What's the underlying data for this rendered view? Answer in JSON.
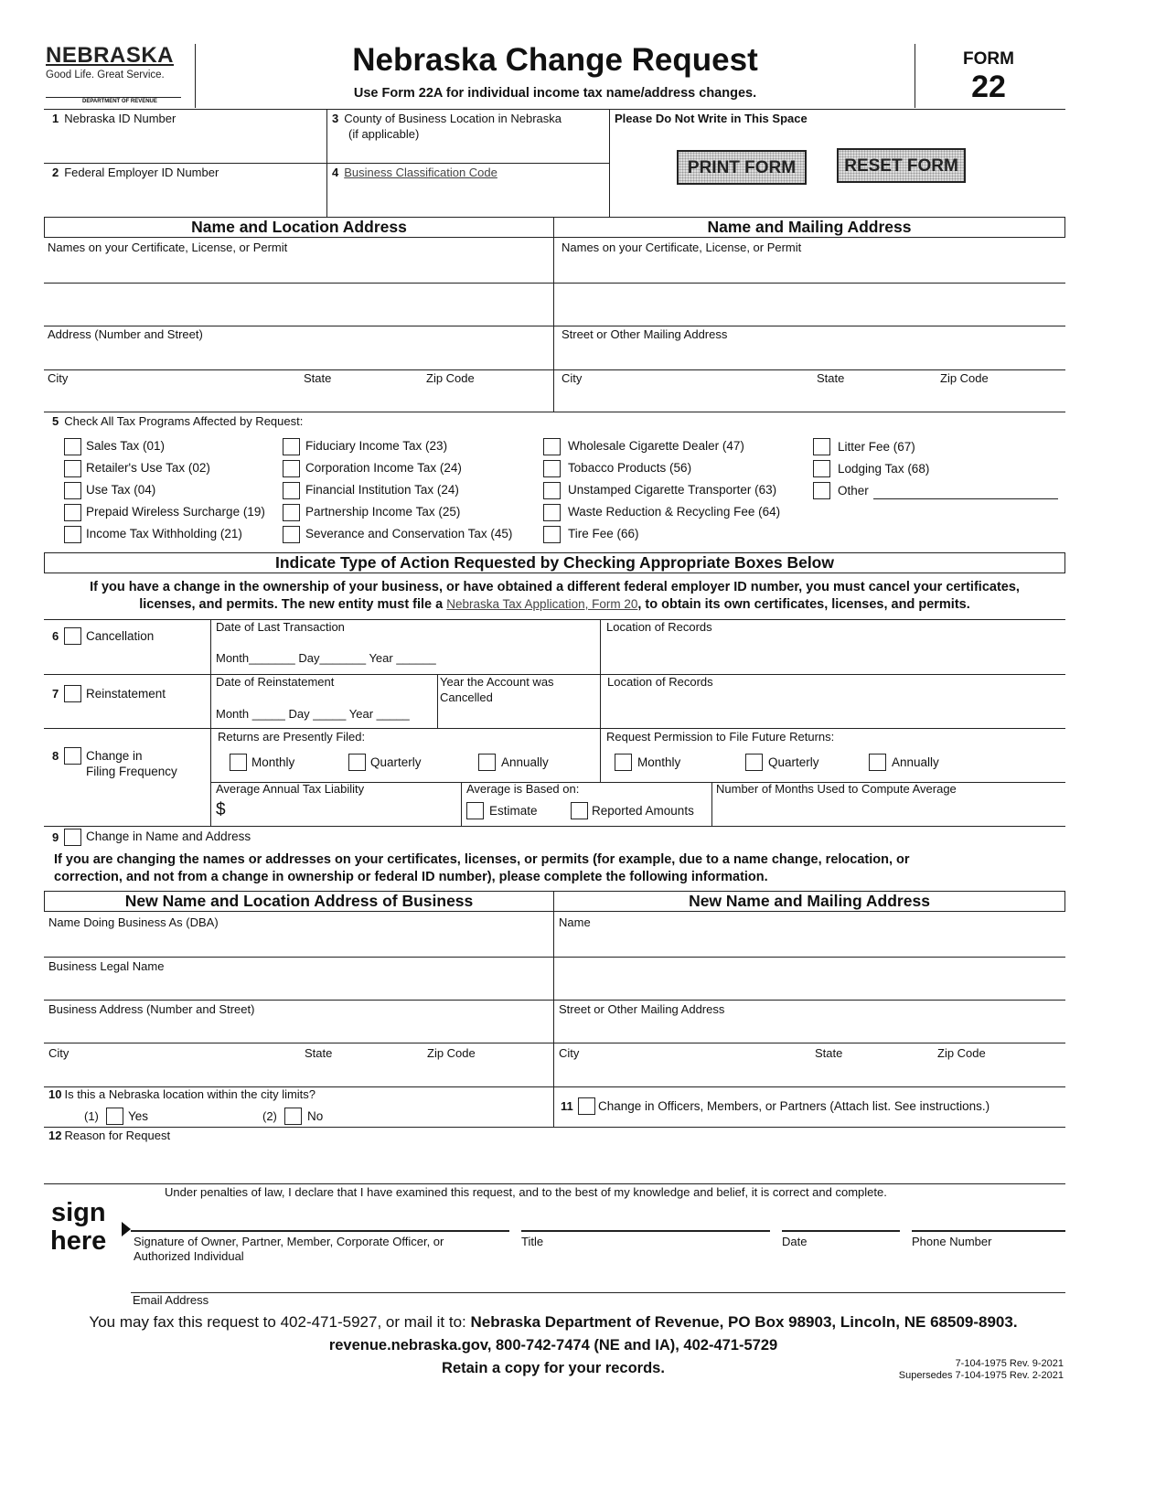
{
  "header": {
    "logo": {
      "name": "NEBRASKA",
      "tagline": "Good Life. Great Service.",
      "department": "DEPARTMENT OF REVENUE"
    },
    "title": "Nebraska Change Request",
    "subtitle": "Use Form 22A for individual income tax name/address changes.",
    "form_label": "FORM",
    "form_number": "22"
  },
  "top_fields": {
    "f1": {
      "num": "1",
      "label": "Nebraska ID Number"
    },
    "f2": {
      "num": "2",
      "label": "Federal Employer ID Number"
    },
    "f3": {
      "num": "3",
      "label": "County of Business Location in Nebraska",
      "label2": "(if applicable)"
    },
    "f4": {
      "num": "4",
      "label": "Business Classification Code"
    },
    "office_use": "Please Do Not Write in This Space",
    "print_button": "PRINT FORM",
    "reset_button": "RESET FORM"
  },
  "address_section": {
    "location_header": "Name and Location Address",
    "mailing_header": "Name and Mailing Address",
    "names_label": "Names on your Certificate, License, or Permit",
    "address_label": "Address (Number and Street)",
    "mailing_address_label": "Street or Other Mailing Address",
    "city": "City",
    "state": "State",
    "zip": "Zip Code"
  },
  "tax_programs": {
    "num": "5",
    "label": "Check All Tax Programs Affected by Request:",
    "col1": [
      "Sales Tax (01)",
      "Retailer's Use Tax (02)",
      "Use Tax (04)",
      "Prepaid Wireless Surcharge (19)",
      "Income Tax Withholding (21)"
    ],
    "col2": [
      "Fiduciary Income Tax (23)",
      "Corporation Income Tax (24)",
      "Financial Institution Tax (24)",
      "Partnership Income Tax (25)",
      "Severance and Conservation Tax (45)"
    ],
    "col3": [
      "Wholesale Cigarette Dealer (47)",
      "Tobacco Products (56)",
      "Unstamped Cigarette Transporter (63)",
      "Waste Reduction & Recycling Fee (64)",
      "Tire Fee (66)"
    ],
    "col4": [
      "Litter Fee (67)",
      "Lodging Tax (68)",
      "Other"
    ]
  },
  "action_section": {
    "header": "Indicate Type of Action Requested by Checking Appropriate Boxes Below",
    "notice_part1": "If you have a change in the ownership of your business, or have obtained a different federal employer ID number, you must cancel your certificates,",
    "notice_part2": "licenses, and permits. The new entity must file a ",
    "notice_link": "Nebraska Tax Application, Form 20",
    "notice_part3": ", to obtain its own certificates, licenses, and permits.",
    "cancellation": {
      "num": "6",
      "label": "Cancellation",
      "date_label": "Date of Last Transaction",
      "date_line": "Month_______  Day_______  Year ______",
      "records_label": "Location of Records"
    },
    "reinstatement": {
      "num": "7",
      "label": "Reinstatement",
      "date_label": "Date of Reinstatement",
      "date_line": "Month _____ Day _____ Year _____",
      "year_cancelled_label": "Year the Account was",
      "year_cancelled_label2": "Cancelled",
      "records_label": "Location of Records"
    },
    "filing_frequency": {
      "num": "8",
      "label": "Change in",
      "label2": "Filing Frequency",
      "present_label": "Returns are Presently Filed:",
      "future_label": "Request Permission to File Future Returns:",
      "options": [
        "Monthly",
        "Quarterly",
        "Annually"
      ],
      "liability_label": "Average Annual Tax Liability",
      "dollar": "$",
      "based_on_label": "Average is Based on:",
      "based_options": [
        "Estimate",
        "Reported Amounts"
      ],
      "months_label": "Number of Months Used to Compute Average"
    },
    "name_change": {
      "num": "9",
      "label": "Change in Name and Address",
      "notice_line1": "If you are changing the names or addresses on your certificates, licenses, or permits (for example, due to a name change, relocation, or",
      "notice_line2": "correction, and not from a change in ownership or federal ID number), please complete the following information."
    }
  },
  "new_address_section": {
    "location_header": "New Name and Location Address of Business",
    "mailing_header": "New Name and Mailing Address",
    "dba_label": "Name Doing Business As (DBA)",
    "name_label": "Name",
    "legal_name_label": "Business Legal Name",
    "business_address_label": "Business Address (Number and Street)",
    "mailing_address_label": "Street or Other Mailing Address",
    "city": "City",
    "state": "State",
    "zip": "Zip Code"
  },
  "q10": {
    "num": "10",
    "label": "Is this a Nebraska location within the city limits?",
    "opt1_num": "(1)",
    "opt1": "Yes",
    "opt2_num": "(2)",
    "opt2": "No"
  },
  "q11": {
    "num": "11",
    "label": "Change in Officers, Members, or Partners (Attach list. See instructions.)"
  },
  "q12": {
    "num": "12",
    "label": "Reason for Request"
  },
  "signature": {
    "declaration": "Under penalties of law, I declare that I have examined this request, and to the best of my knowledge and belief, it is correct and complete.",
    "sign": "sign",
    "here": "here",
    "signature_label": "Signature of Owner, Partner, Member, Corporate Officer, or",
    "signature_label2": "Authorized Individual",
    "title_label": "Title",
    "date_label": "Date",
    "phone_label": "Phone Number",
    "email_label": "Email Address"
  },
  "footer": {
    "fax_text": "You may fax this request to 402-471-5927, or mail it to: ",
    "mail_address": "Nebraska Department of Revenue, PO Box 98903, Lincoln, NE 68509-8903.",
    "contact": "revenue.nebraska.gov, 800-742-7474 (NE and IA), 402-471-5729",
    "retain": "Retain a copy for your records.",
    "rev": "7-104-1975 Rev. 9-2021",
    "supersedes": "Supersedes 7-104-1975 Rev. 2-2021"
  }
}
